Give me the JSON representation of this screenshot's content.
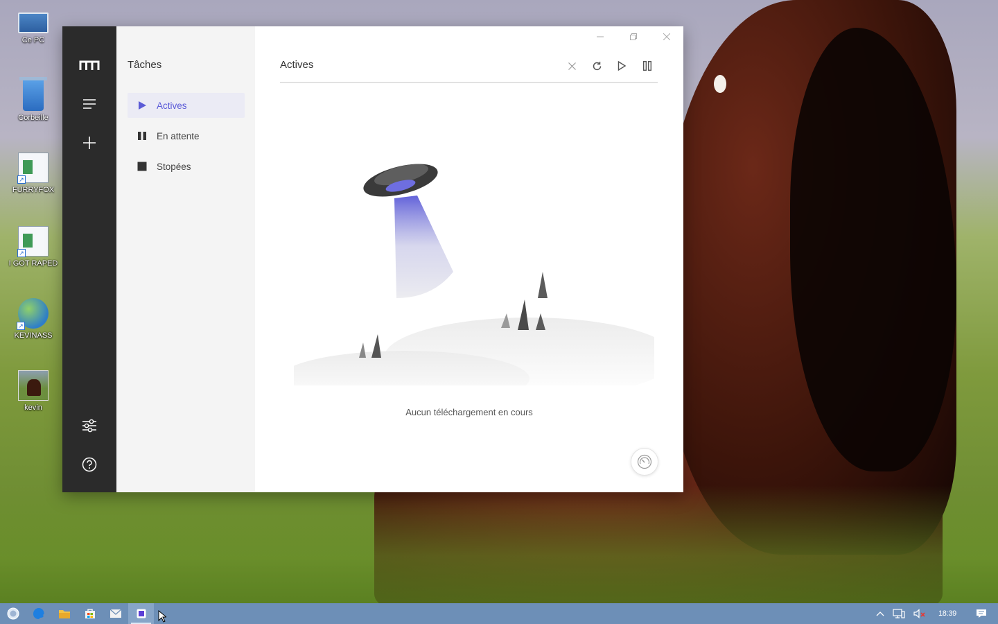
{
  "desktop": {
    "icons": [
      {
        "label": "Ce PC",
        "icon": "computer-icon"
      },
      {
        "label": "Corbeille",
        "icon": "recycle-bin-icon"
      },
      {
        "label": "FURRYFOX",
        "icon": "shortcut-file-icon"
      },
      {
        "label": "I GOT RAPED",
        "icon": "shortcut-file-icon"
      },
      {
        "label": "KEVINASS",
        "icon": "globe-shortcut-icon"
      },
      {
        "label": "kevin",
        "icon": "image-thumbnail-icon"
      }
    ]
  },
  "app": {
    "rail": {
      "logo_icon": "motrix-logo-icon",
      "menu_icon": "menu-icon",
      "add_icon": "plus-icon",
      "settings_icon": "sliders-icon",
      "help_icon": "help-icon"
    },
    "sidebar": {
      "title": "Tâches",
      "items": [
        {
          "label": "Actives",
          "icon": "play-icon",
          "active": true
        },
        {
          "label": "En attente",
          "icon": "pause-icon",
          "active": false
        },
        {
          "label": "Stopées",
          "icon": "stop-icon",
          "active": false
        }
      ]
    },
    "main": {
      "header": "Actives",
      "toolbar": [
        "close-icon",
        "refresh-icon",
        "play-icon",
        "pause-icon"
      ],
      "empty_message": "Aucun téléchargement en cours",
      "speed_icon": "speedometer-icon"
    },
    "window_controls": [
      "minimize-icon",
      "maximize-icon",
      "close-icon"
    ],
    "accent_color": "#5b5bd6"
  },
  "taskbar": {
    "items": [
      "start-icon",
      "edge-icon",
      "file-explorer-icon",
      "store-icon",
      "mail-icon",
      "motrix-app-icon"
    ],
    "tray": {
      "icons": [
        "chevron-up-icon",
        "network-icon",
        "volume-muted-icon"
      ],
      "time": "18:39",
      "notification_icon": "action-center-icon"
    }
  }
}
